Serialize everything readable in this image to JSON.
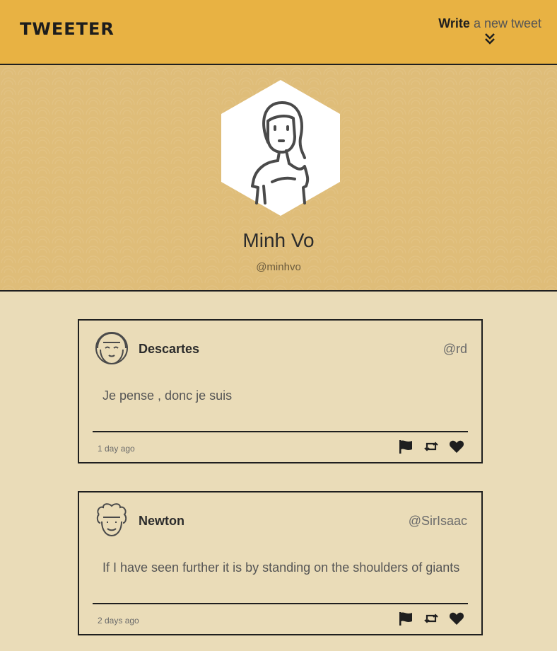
{
  "nav": {
    "brand": "TWEETER",
    "compose_bold": "Write",
    "compose_rest": " a new tweet"
  },
  "profile": {
    "name": "Minh Vo",
    "handle": "@minhvo"
  },
  "tweets": [
    {
      "name": "Descartes",
      "handle": "@rd",
      "text": "Je pense , donc je suis",
      "time": "1 day ago"
    },
    {
      "name": "Newton",
      "handle": "@SirIsaac",
      "text": "If I have seen further it is by standing on the shoulders of giants",
      "time": "2 days ago"
    }
  ],
  "icons": {
    "compose": "double-chevron-down-icon",
    "flag": "flag-icon",
    "retweet": "retweet-icon",
    "like": "heart-icon"
  },
  "colors": {
    "nav_bg": "#e8b243",
    "hero_bg": "#dfbd79",
    "page_bg": "#eadcb8",
    "border": "#1f1f1f"
  }
}
